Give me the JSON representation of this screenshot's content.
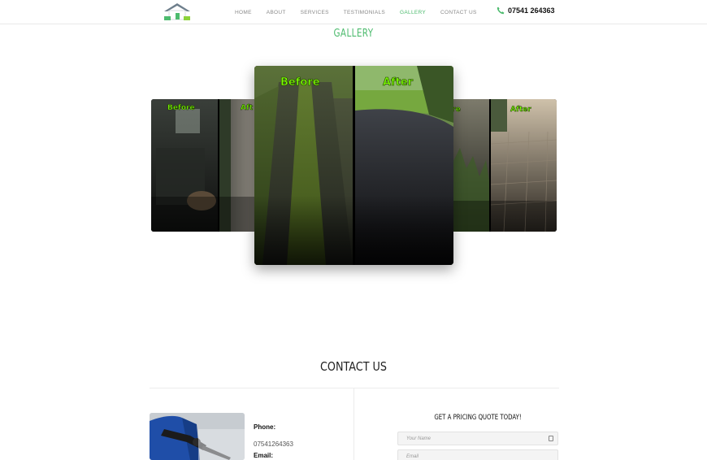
{
  "header": {
    "nav": [
      {
        "label": "HOME",
        "active": false
      },
      {
        "label": "ABOUT",
        "active": false
      },
      {
        "label": "SERVICES",
        "active": false
      },
      {
        "label": "TESTIMONIALS",
        "active": false
      },
      {
        "label": "GALLERY",
        "active": true
      },
      {
        "label": "CONTACT US",
        "active": false
      }
    ],
    "phone": "07541 264363",
    "phone_icon": "phone-icon"
  },
  "gallery": {
    "title": "GALLERY",
    "slides": [
      {
        "before_label": "Before",
        "after_label": "Aft"
      },
      {
        "before_label": "Before",
        "after_label": "After"
      },
      {
        "before_label": "ore",
        "after_label": "After"
      }
    ]
  },
  "contact": {
    "title": "CONTACT US",
    "phone_label": "Phone:",
    "phone_value": "07541264363",
    "email_label": "Email:",
    "quote_title": "GET A PRICING QUOTE TODAY!",
    "name_placeholder": "Your Name",
    "email_placeholder": "Email"
  },
  "colors": {
    "accent": "#4dbb6e",
    "label_green": "#7cff00"
  }
}
